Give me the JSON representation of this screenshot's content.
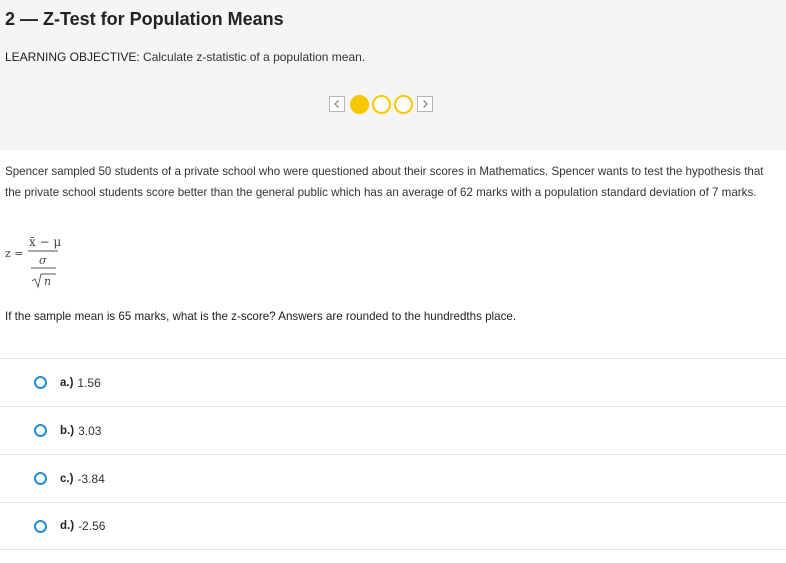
{
  "header": {
    "title": "2 — Z-Test for Population Means",
    "objective_label": "LEARNING OBJECTIVE:",
    "objective_text": " Calculate z-statistic of a population mean."
  },
  "pager": {
    "total": 3,
    "current": 1,
    "prev_icon": "chevron-left-icon",
    "next_icon": "chevron-right-icon"
  },
  "problem": {
    "text": "Spencer sampled 50 students of a private school who were questioned about their scores in Mathematics. Spencer wants to test the hypothesis that the private school students score better than the general public which has an average of 62 marks with a population standard deviation of 7 marks."
  },
  "formula": {
    "lhs": "z =",
    "numerator": "x̄ − μ",
    "denominator_top": "σ",
    "denominator_bottom": "n"
  },
  "question": {
    "text": "If the sample mean is 65 marks, what is the z-score? Answers are rounded to the hundredths place."
  },
  "answers": [
    {
      "letter": "a.)",
      "value": "1.56"
    },
    {
      "letter": "b.)",
      "value": "3.03"
    },
    {
      "letter": "c.)",
      "value": "-3.84"
    },
    {
      "letter": "d.)",
      "value": "-2.56"
    }
  ],
  "colors": {
    "accent_yellow": "#f9c700",
    "radio_blue": "#1f8fd6",
    "header_bg": "#f5f5f5"
  }
}
